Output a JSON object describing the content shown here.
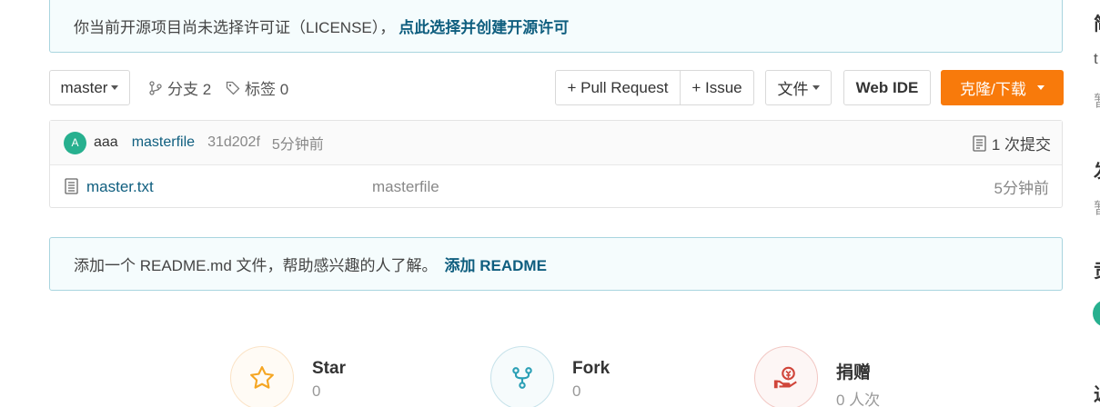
{
  "license_notice": {
    "text": "你当前开源项目尚未选择许可证（LICENSE），",
    "link": "点此选择并创建开源许可"
  },
  "toolbar": {
    "branch": "master",
    "branches_label": "分支 2",
    "tags_label": "标签 0",
    "pull_request": "+ Pull Request",
    "issue": "+ Issue",
    "file": "文件",
    "web_ide": "Web IDE",
    "clone": "克隆/下载"
  },
  "last_commit": {
    "avatar_letter": "A",
    "author": "aaa",
    "message": "masterfile",
    "hash": "31d202f",
    "time": "5分钟前",
    "commit_count": "1 次提交"
  },
  "files": [
    {
      "name": "master.txt",
      "message": "masterfile",
      "time": "5分钟前"
    }
  ],
  "readme_notice": {
    "text": "添加一个 README.md 文件，帮助感兴趣的人了解。",
    "link": "添加 README"
  },
  "stats": {
    "star": {
      "label": "Star",
      "count": "0"
    },
    "fork": {
      "label": "Fork",
      "count": "0"
    },
    "donate": {
      "label": "捐赠",
      "count": "0 人次"
    }
  },
  "side_peek": [
    "简",
    "t",
    "暂",
    "发",
    "暂",
    "贡",
    "近"
  ],
  "colors": {
    "accent": "#f87a0b",
    "link": "#0f5e7f",
    "avatar": "#27b08f"
  }
}
